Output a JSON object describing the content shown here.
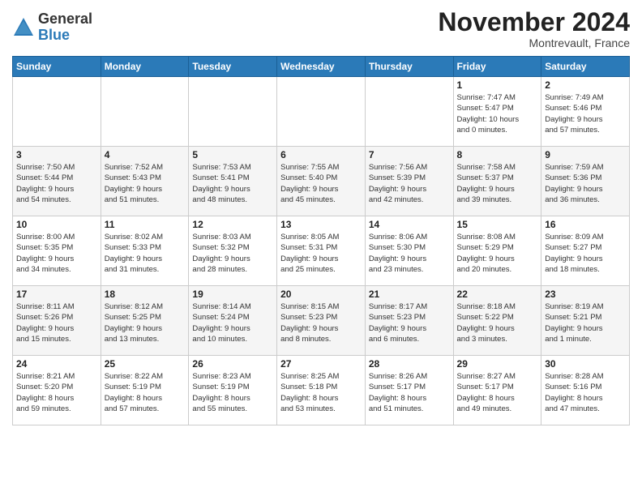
{
  "header": {
    "logo_general": "General",
    "logo_blue": "Blue",
    "month_title": "November 2024",
    "subtitle": "Montrevault, France"
  },
  "days_of_week": [
    "Sunday",
    "Monday",
    "Tuesday",
    "Wednesday",
    "Thursday",
    "Friday",
    "Saturday"
  ],
  "weeks": [
    [
      {
        "day": "",
        "info": ""
      },
      {
        "day": "",
        "info": ""
      },
      {
        "day": "",
        "info": ""
      },
      {
        "day": "",
        "info": ""
      },
      {
        "day": "",
        "info": ""
      },
      {
        "day": "1",
        "info": "Sunrise: 7:47 AM\nSunset: 5:47 PM\nDaylight: 10 hours\nand 0 minutes."
      },
      {
        "day": "2",
        "info": "Sunrise: 7:49 AM\nSunset: 5:46 PM\nDaylight: 9 hours\nand 57 minutes."
      }
    ],
    [
      {
        "day": "3",
        "info": "Sunrise: 7:50 AM\nSunset: 5:44 PM\nDaylight: 9 hours\nand 54 minutes."
      },
      {
        "day": "4",
        "info": "Sunrise: 7:52 AM\nSunset: 5:43 PM\nDaylight: 9 hours\nand 51 minutes."
      },
      {
        "day": "5",
        "info": "Sunrise: 7:53 AM\nSunset: 5:41 PM\nDaylight: 9 hours\nand 48 minutes."
      },
      {
        "day": "6",
        "info": "Sunrise: 7:55 AM\nSunset: 5:40 PM\nDaylight: 9 hours\nand 45 minutes."
      },
      {
        "day": "7",
        "info": "Sunrise: 7:56 AM\nSunset: 5:39 PM\nDaylight: 9 hours\nand 42 minutes."
      },
      {
        "day": "8",
        "info": "Sunrise: 7:58 AM\nSunset: 5:37 PM\nDaylight: 9 hours\nand 39 minutes."
      },
      {
        "day": "9",
        "info": "Sunrise: 7:59 AM\nSunset: 5:36 PM\nDaylight: 9 hours\nand 36 minutes."
      }
    ],
    [
      {
        "day": "10",
        "info": "Sunrise: 8:00 AM\nSunset: 5:35 PM\nDaylight: 9 hours\nand 34 minutes."
      },
      {
        "day": "11",
        "info": "Sunrise: 8:02 AM\nSunset: 5:33 PM\nDaylight: 9 hours\nand 31 minutes."
      },
      {
        "day": "12",
        "info": "Sunrise: 8:03 AM\nSunset: 5:32 PM\nDaylight: 9 hours\nand 28 minutes."
      },
      {
        "day": "13",
        "info": "Sunrise: 8:05 AM\nSunset: 5:31 PM\nDaylight: 9 hours\nand 25 minutes."
      },
      {
        "day": "14",
        "info": "Sunrise: 8:06 AM\nSunset: 5:30 PM\nDaylight: 9 hours\nand 23 minutes."
      },
      {
        "day": "15",
        "info": "Sunrise: 8:08 AM\nSunset: 5:29 PM\nDaylight: 9 hours\nand 20 minutes."
      },
      {
        "day": "16",
        "info": "Sunrise: 8:09 AM\nSunset: 5:27 PM\nDaylight: 9 hours\nand 18 minutes."
      }
    ],
    [
      {
        "day": "17",
        "info": "Sunrise: 8:11 AM\nSunset: 5:26 PM\nDaylight: 9 hours\nand 15 minutes."
      },
      {
        "day": "18",
        "info": "Sunrise: 8:12 AM\nSunset: 5:25 PM\nDaylight: 9 hours\nand 13 minutes."
      },
      {
        "day": "19",
        "info": "Sunrise: 8:14 AM\nSunset: 5:24 PM\nDaylight: 9 hours\nand 10 minutes."
      },
      {
        "day": "20",
        "info": "Sunrise: 8:15 AM\nSunset: 5:23 PM\nDaylight: 9 hours\nand 8 minutes."
      },
      {
        "day": "21",
        "info": "Sunrise: 8:17 AM\nSunset: 5:23 PM\nDaylight: 9 hours\nand 6 minutes."
      },
      {
        "day": "22",
        "info": "Sunrise: 8:18 AM\nSunset: 5:22 PM\nDaylight: 9 hours\nand 3 minutes."
      },
      {
        "day": "23",
        "info": "Sunrise: 8:19 AM\nSunset: 5:21 PM\nDaylight: 9 hours\nand 1 minute."
      }
    ],
    [
      {
        "day": "24",
        "info": "Sunrise: 8:21 AM\nSunset: 5:20 PM\nDaylight: 8 hours\nand 59 minutes."
      },
      {
        "day": "25",
        "info": "Sunrise: 8:22 AM\nSunset: 5:19 PM\nDaylight: 8 hours\nand 57 minutes."
      },
      {
        "day": "26",
        "info": "Sunrise: 8:23 AM\nSunset: 5:19 PM\nDaylight: 8 hours\nand 55 minutes."
      },
      {
        "day": "27",
        "info": "Sunrise: 8:25 AM\nSunset: 5:18 PM\nDaylight: 8 hours\nand 53 minutes."
      },
      {
        "day": "28",
        "info": "Sunrise: 8:26 AM\nSunset: 5:17 PM\nDaylight: 8 hours\nand 51 minutes."
      },
      {
        "day": "29",
        "info": "Sunrise: 8:27 AM\nSunset: 5:17 PM\nDaylight: 8 hours\nand 49 minutes."
      },
      {
        "day": "30",
        "info": "Sunrise: 8:28 AM\nSunset: 5:16 PM\nDaylight: 8 hours\nand 47 minutes."
      }
    ]
  ]
}
